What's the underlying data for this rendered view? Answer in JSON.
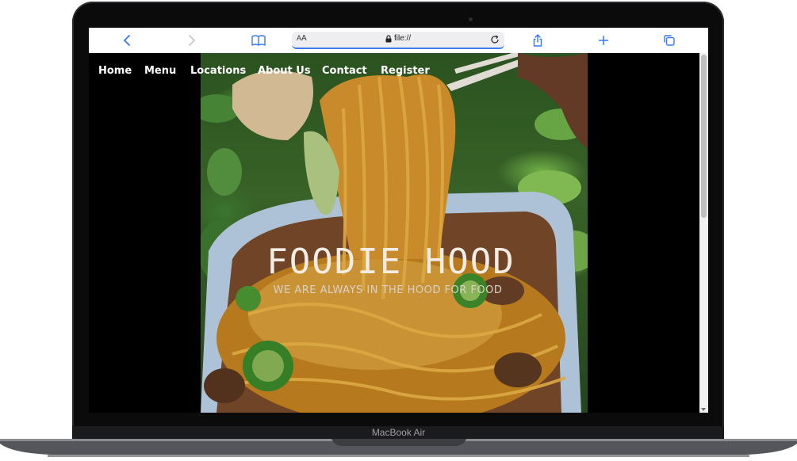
{
  "browser": {
    "url": "file://",
    "text_size_label_small": "A",
    "text_size_label_large": "A"
  },
  "nav": {
    "items": [
      "Home",
      "Menu",
      "Locations",
      "About Us",
      "Contact",
      "Register"
    ]
  },
  "hero": {
    "title": "FOODIE HOOD",
    "subtitle": "WE ARE ALWAYS IN THE HOOD FOR FOOD"
  },
  "device": {
    "label": "MacBook Air"
  }
}
